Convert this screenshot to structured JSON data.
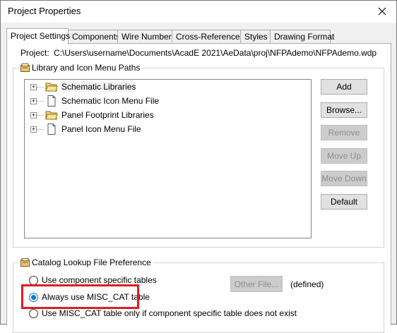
{
  "window": {
    "title": "Project Properties"
  },
  "tabs": [
    {
      "label": "Project Settings",
      "active": true
    },
    {
      "label": "Components"
    },
    {
      "label": "Wire Numbers"
    },
    {
      "label": "Cross-References"
    },
    {
      "label": "Styles"
    },
    {
      "label": "Drawing Format"
    }
  ],
  "project": {
    "label": "Project:",
    "path": "C:\\Users\\username\\Documents\\AcadE 2021\\AeData\\proj\\NFPAdemo\\NFPAdemo.wdp"
  },
  "library_group": {
    "caption": "Library and Icon Menu Paths",
    "tree": [
      {
        "label": "Schematic Libraries",
        "icon": "folder-icon",
        "selected": true
      },
      {
        "label": "Schematic Icon Menu File",
        "icon": "file-icon"
      },
      {
        "label": "Panel Footprint Libraries",
        "icon": "folder-icon"
      },
      {
        "label": "Panel Icon Menu File",
        "icon": "file-icon"
      }
    ],
    "buttons": {
      "add": "Add",
      "browse": "Browse...",
      "remove": "Remove",
      "move_up": "Move Up",
      "move_down": "Move Down",
      "default": "Default"
    }
  },
  "catalog_group": {
    "caption": "Catalog Lookup File Preference",
    "options": [
      {
        "label": "Use component specific tables",
        "checked": false
      },
      {
        "label": "Always use MISC_CAT table",
        "checked": true
      },
      {
        "label": "Use MISC_CAT table only if component specific table does not exist",
        "checked": false
      }
    ],
    "other_file_button": "Other File...",
    "defined_text": "(defined)"
  },
  "colors": {
    "accent": "#0078d7",
    "highlight": "#e11b22"
  }
}
